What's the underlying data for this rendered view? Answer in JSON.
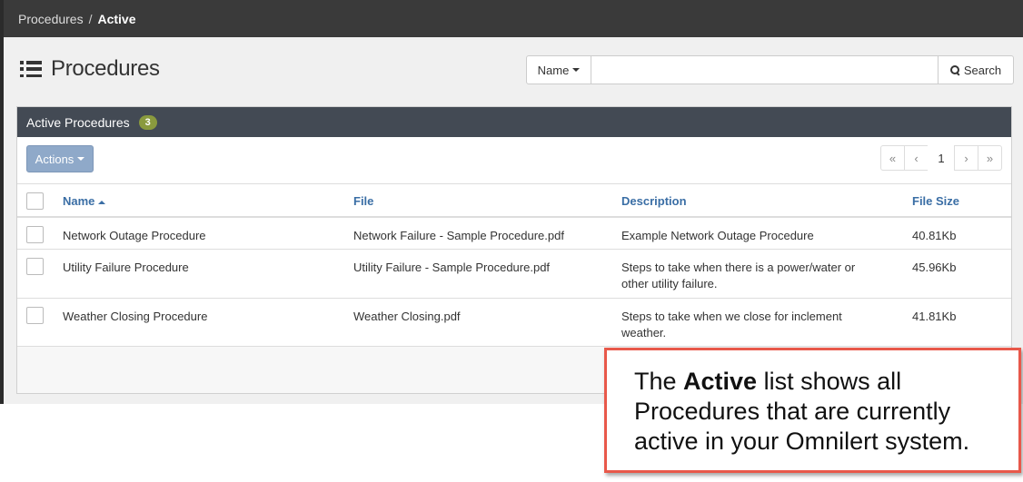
{
  "breadcrumb": {
    "parent": "Procedures",
    "separator": "/",
    "current": "Active"
  },
  "page": {
    "title": "Procedures",
    "icon": "list-icon"
  },
  "search": {
    "field_label": "Name",
    "input_value": "",
    "button_label": "Search",
    "button_icon": "search-icon"
  },
  "panel": {
    "title": "Active Procedures",
    "count": "3",
    "actions_label": "Actions"
  },
  "pagination": {
    "first": "«",
    "prev": "‹",
    "current": "1",
    "next": "›",
    "last": "»"
  },
  "table": {
    "headers": {
      "name": "Name",
      "file": "File",
      "description": "Description",
      "size": "File Size"
    },
    "rows": [
      {
        "name": "Network Outage Procedure",
        "file": "Network Failure - Sample Procedure.pdf",
        "description": "Example Network Outage Procedure",
        "size": "40.81Kb"
      },
      {
        "name": "Utility Failure Procedure",
        "file": "Utility Failure - Sample Procedure.pdf",
        "description": "Steps to take when there is a power/water or other utility failure.",
        "size": "45.96Kb"
      },
      {
        "name": "Weather Closing Procedure",
        "file": "Weather Closing.pdf",
        "description": "Steps to take when we close for inclement weather.",
        "size": "41.81Kb"
      }
    ]
  },
  "callout": {
    "prefix": "The ",
    "bold": "Active",
    "suffix": " list shows all Procedures that are currently active in your Omnilert system."
  },
  "colors": {
    "topbar": "#3a3a3a",
    "panel_header": "#434a54",
    "badge": "#8a9a3e",
    "link": "#3a6ea5",
    "actions_button": "#8fa9c9",
    "callout_border": "#e8584a"
  }
}
